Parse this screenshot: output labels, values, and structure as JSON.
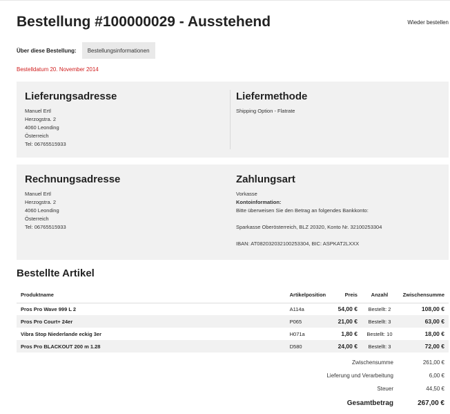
{
  "header": {
    "title": "Bestellung #100000029 - Ausstehend",
    "reorder_link": "Wieder bestellen"
  },
  "about": {
    "label": "Über diese Bestellung:",
    "tab": "Bestellungsinformationen"
  },
  "order_date": "Bestelldatum 20. November 2014",
  "shipping_address": {
    "title": "Lieferungsadresse",
    "lines": [
      "Manuel Ertl",
      "Herzogstra. 2",
      "4060 Leonding",
      "Österreich",
      "Tel: 06765515933"
    ]
  },
  "shipping_method": {
    "title": "Liefermethode",
    "value": "Shipping Option - Flatrate"
  },
  "billing_address": {
    "title": "Rechnungsadresse",
    "lines": [
      "Manuel Ertl",
      "Herzogstra. 2",
      "4060 Leonding",
      "Österreich",
      "Tel: 06765515933"
    ]
  },
  "payment": {
    "title": "Zahlungsart",
    "method": "Vorkasse",
    "info_label": "Kontoinformation:",
    "instruction": "Bitte überweisen Sie den Betrag an folgendes Bankkonto:",
    "bank": "Sparkasse Oberösterreich, BLZ 20320, Konto Nr. 32100253304",
    "iban": "IBAN: AT082032032100253304, BIC: ASPKAT2LXXX"
  },
  "items_section": {
    "title": "Bestellte Artikel",
    "columns": [
      "Produktname",
      "Artikelposition",
      "Preis",
      "Anzahl",
      "Zwischensumme"
    ],
    "rows": [
      {
        "name": "Pros Pro Wave 999 L 2",
        "sku": "A114a",
        "price": "54,00 €",
        "qty": "Bestellt: 2",
        "subtotal": "108,00 €"
      },
      {
        "name": "Pros Pro Court+ 24er",
        "sku": "P065",
        "price": "21,00 €",
        "qty": "Bestellt: 3",
        "subtotal": "63,00 €"
      },
      {
        "name": "Vibra Stop Niederlande eckig 3er",
        "sku": "H071a",
        "price": "1,80 €",
        "qty": "Bestellt: 10",
        "subtotal": "18,00 €"
      },
      {
        "name": "Pros Pro BLACKOUT 200 m 1.28",
        "sku": "D580",
        "price": "24,00 €",
        "qty": "Bestellt: 3",
        "subtotal": "72,00 €"
      }
    ]
  },
  "totals": {
    "subtotal_label": "Zwischensumme",
    "subtotal": "261,00 €",
    "shipping_label": "Lieferung und Verarbeitung",
    "shipping": "6,00 €",
    "tax_label": "Steuer",
    "tax": "44,50 €",
    "grand_label": "Gesamtbetrag",
    "grand": "267,00 €"
  }
}
